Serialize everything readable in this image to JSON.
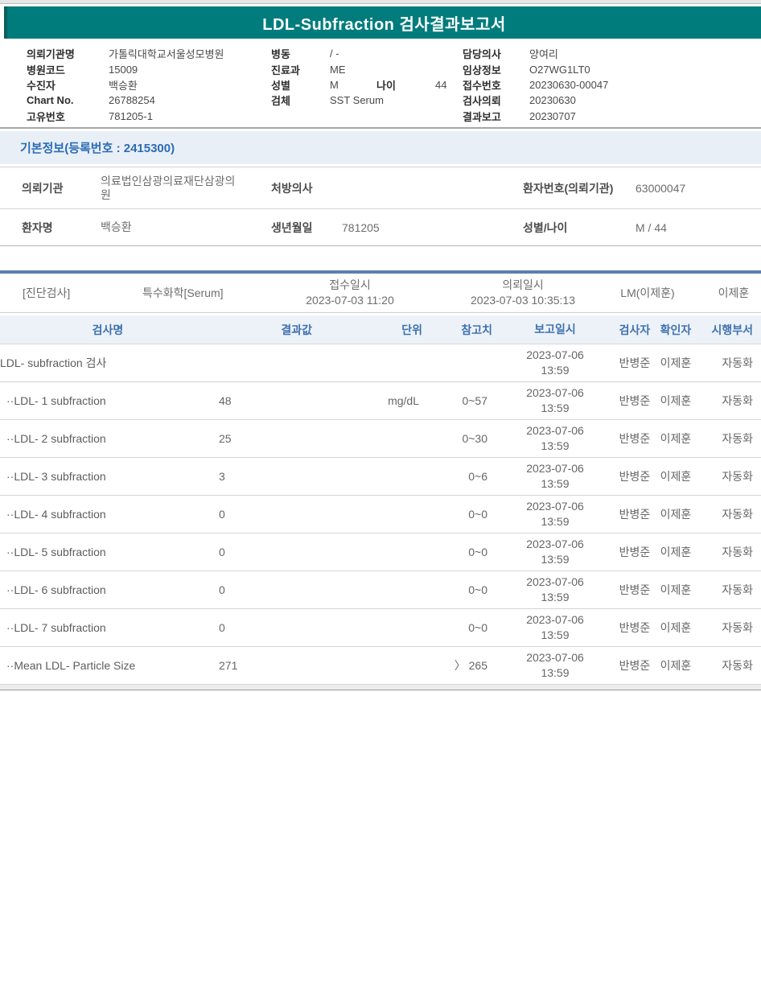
{
  "title": "LDL-Subfraction 검사결과보고서",
  "header": {
    "col1": [
      {
        "label": "의뢰기관명",
        "value": "가톨릭대학교서울성모병원"
      },
      {
        "label": "병원코드",
        "value": "15009"
      },
      {
        "label": "수진자",
        "value": "백승환"
      },
      {
        "label": "Chart No.",
        "value": "26788254"
      },
      {
        "label": "고유번호",
        "value": "781205-1"
      }
    ],
    "col2": [
      {
        "label": "병동",
        "value": "/ -"
      },
      {
        "label": "진료과",
        "value": "ME"
      },
      {
        "label": "성별",
        "value": "M",
        "label2": "나이",
        "value2": "44"
      },
      {
        "label": "검체",
        "value": "SST Serum"
      }
    ],
    "col3": [
      {
        "label": "담당의사",
        "value": "양여리"
      },
      {
        "label": "임상정보",
        "value": "O27WG1LT0"
      },
      {
        "label": "접수번호",
        "value": "20230630-00047"
      },
      {
        "label": "검사의뢰",
        "value": "20230630"
      },
      {
        "label": "결과보고",
        "value": "20230707"
      }
    ]
  },
  "basic_info": {
    "section_title": "기본정보(등록번호 : 2415300)",
    "rows": [
      [
        {
          "label": "의뢰기관",
          "value": "의료법인삼광의료재단삼광의원"
        },
        {
          "label": "처방의사",
          "value": ""
        },
        {
          "label": "환자번호(의뢰기관)",
          "value": "63000047"
        }
      ],
      [
        {
          "label": "환자명",
          "value": "백승환"
        },
        {
          "label": "생년월일",
          "value": "781205"
        },
        {
          "label": "성별/나이",
          "value": "M / 44"
        }
      ]
    ]
  },
  "test_info": {
    "category": "[진단검사]",
    "test_type": "특수화학[Serum]",
    "receipt_label": "접수일시",
    "receipt_datetime": "2023-07-03 11:20",
    "request_label": "의뢰일시",
    "request_datetime": "2023-07-03 10:35:13",
    "lab_section": "LM(이제훈)",
    "reporter": "이제훈"
  },
  "results_table": {
    "headers": [
      "검사명",
      "결과값",
      "단위",
      "참고치",
      "보고일시",
      "검사자",
      "확인자",
      "시행부서"
    ],
    "rows": [
      {
        "name": "LDL- subfraction 검사",
        "result": "",
        "unit": "",
        "ref": "",
        "date": "2023-07-06",
        "time": "13:59",
        "tester": "반병준",
        "verifier": "이제훈",
        "dept": "자동화"
      },
      {
        "name": "··LDL- 1 subfraction",
        "result": "48",
        "unit": "mg/dL",
        "ref": "0~57",
        "date": "2023-07-06",
        "time": "13:59",
        "tester": "반병준",
        "verifier": "이제훈",
        "dept": "자동화"
      },
      {
        "name": "··LDL- 2 subfraction",
        "result": "25",
        "unit": "",
        "ref": "0~30",
        "date": "2023-07-06",
        "time": "13:59",
        "tester": "반병준",
        "verifier": "이제훈",
        "dept": "자동화"
      },
      {
        "name": "··LDL- 3 subfraction",
        "result": "3",
        "unit": "",
        "ref": "0~6",
        "date": "2023-07-06",
        "time": "13:59",
        "tester": "반병준",
        "verifier": "이제훈",
        "dept": "자동화"
      },
      {
        "name": "··LDL- 4 subfraction",
        "result": "0",
        "unit": "",
        "ref": "0~0",
        "date": "2023-07-06",
        "time": "13:59",
        "tester": "반병준",
        "verifier": "이제훈",
        "dept": "자동화"
      },
      {
        "name": "··LDL- 5 subfraction",
        "result": "0",
        "unit": "",
        "ref": "0~0",
        "date": "2023-07-06",
        "time": "13:59",
        "tester": "반병준",
        "verifier": "이제훈",
        "dept": "자동화"
      },
      {
        "name": "··LDL- 6 subfraction",
        "result": "0",
        "unit": "",
        "ref": "0~0",
        "date": "2023-07-06",
        "time": "13:59",
        "tester": "반병준",
        "verifier": "이제훈",
        "dept": "자동화"
      },
      {
        "name": "··LDL- 7 subfraction",
        "result": "0",
        "unit": "",
        "ref": "0~0",
        "date": "2023-07-06",
        "time": "13:59",
        "tester": "반병준",
        "verifier": "이제훈",
        "dept": "자동화"
      },
      {
        "name": "··Mean LDL- Particle Size",
        "result": "271",
        "unit": "",
        "ref": "〉 265",
        "date": "2023-07-06",
        "time": "13:59",
        "tester": "반병준",
        "verifier": "이제훈",
        "dept": "자동화"
      }
    ]
  },
  "colors": {
    "title_bar_teal": "#007c7d",
    "section_bg_blue": "#e9eff7",
    "section_title_blue": "#2a6cb5",
    "table_header_blue": "#3f72ae",
    "steel_divider_blue": "#5b81ab",
    "body_text_gray": "#666666"
  }
}
